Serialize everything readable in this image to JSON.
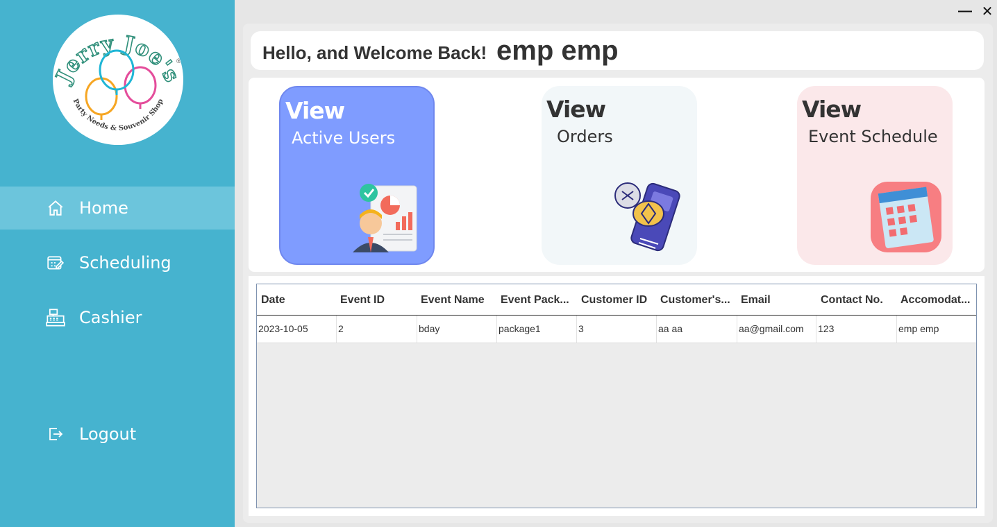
{
  "window": {
    "minimize_glyph": "—",
    "close_glyph": "✕"
  },
  "brand": {
    "logo_text": "Jerry Joe's",
    "logo_tagline": "Party Needs & Souvenir Shop",
    "logo_trademark": "®"
  },
  "sidebar": {
    "items": [
      {
        "label": "Home",
        "icon": "home-icon",
        "active": true
      },
      {
        "label": "Scheduling",
        "icon": "calendar-edit-icon",
        "active": false
      },
      {
        "label": "Cashier",
        "icon": "cash-register-icon",
        "active": false
      }
    ],
    "logout": {
      "label": "Logout",
      "icon": "logout-icon"
    }
  },
  "header": {
    "greeting": "Hello, and Welcome Back!",
    "username": "emp emp"
  },
  "cards": [
    {
      "title": "View",
      "subtitle": "Active Users",
      "icon": "user-report-icon",
      "bg": "#7f9cff",
      "border": "#6f87ee",
      "title_color": "#ffffff",
      "sub_color": "#ffffff"
    },
    {
      "title": "View",
      "subtitle": "Orders",
      "icon": "payment-terminal-icon",
      "bg": "#f2f7f9",
      "border": "#f2f7f9",
      "title_color": "#333333",
      "sub_color": "#333333"
    },
    {
      "title": "View",
      "subtitle": "Event Schedule",
      "icon": "calendar-icon",
      "bg": "#fbe8ea",
      "border": "#fbe8ea",
      "title_color": "#333333",
      "sub_color": "#333333"
    }
  ],
  "table": {
    "columns": [
      "Date",
      "Event ID",
      "Event Name",
      "Event Pack...",
      "Customer ID",
      "Customer's...",
      "Email",
      "Contact No.",
      "Accomodat..."
    ],
    "rows": [
      [
        "2023-10-05",
        "2",
        "bday",
        "package1",
        "3",
        "aa aa",
        "aa@gmail.com",
        "123",
        "emp emp"
      ]
    ]
  },
  "colors": {
    "sidebar": "#46b3cf",
    "sidebar_active": "#6cc5dc",
    "accent_blue": "#7f9cff"
  }
}
